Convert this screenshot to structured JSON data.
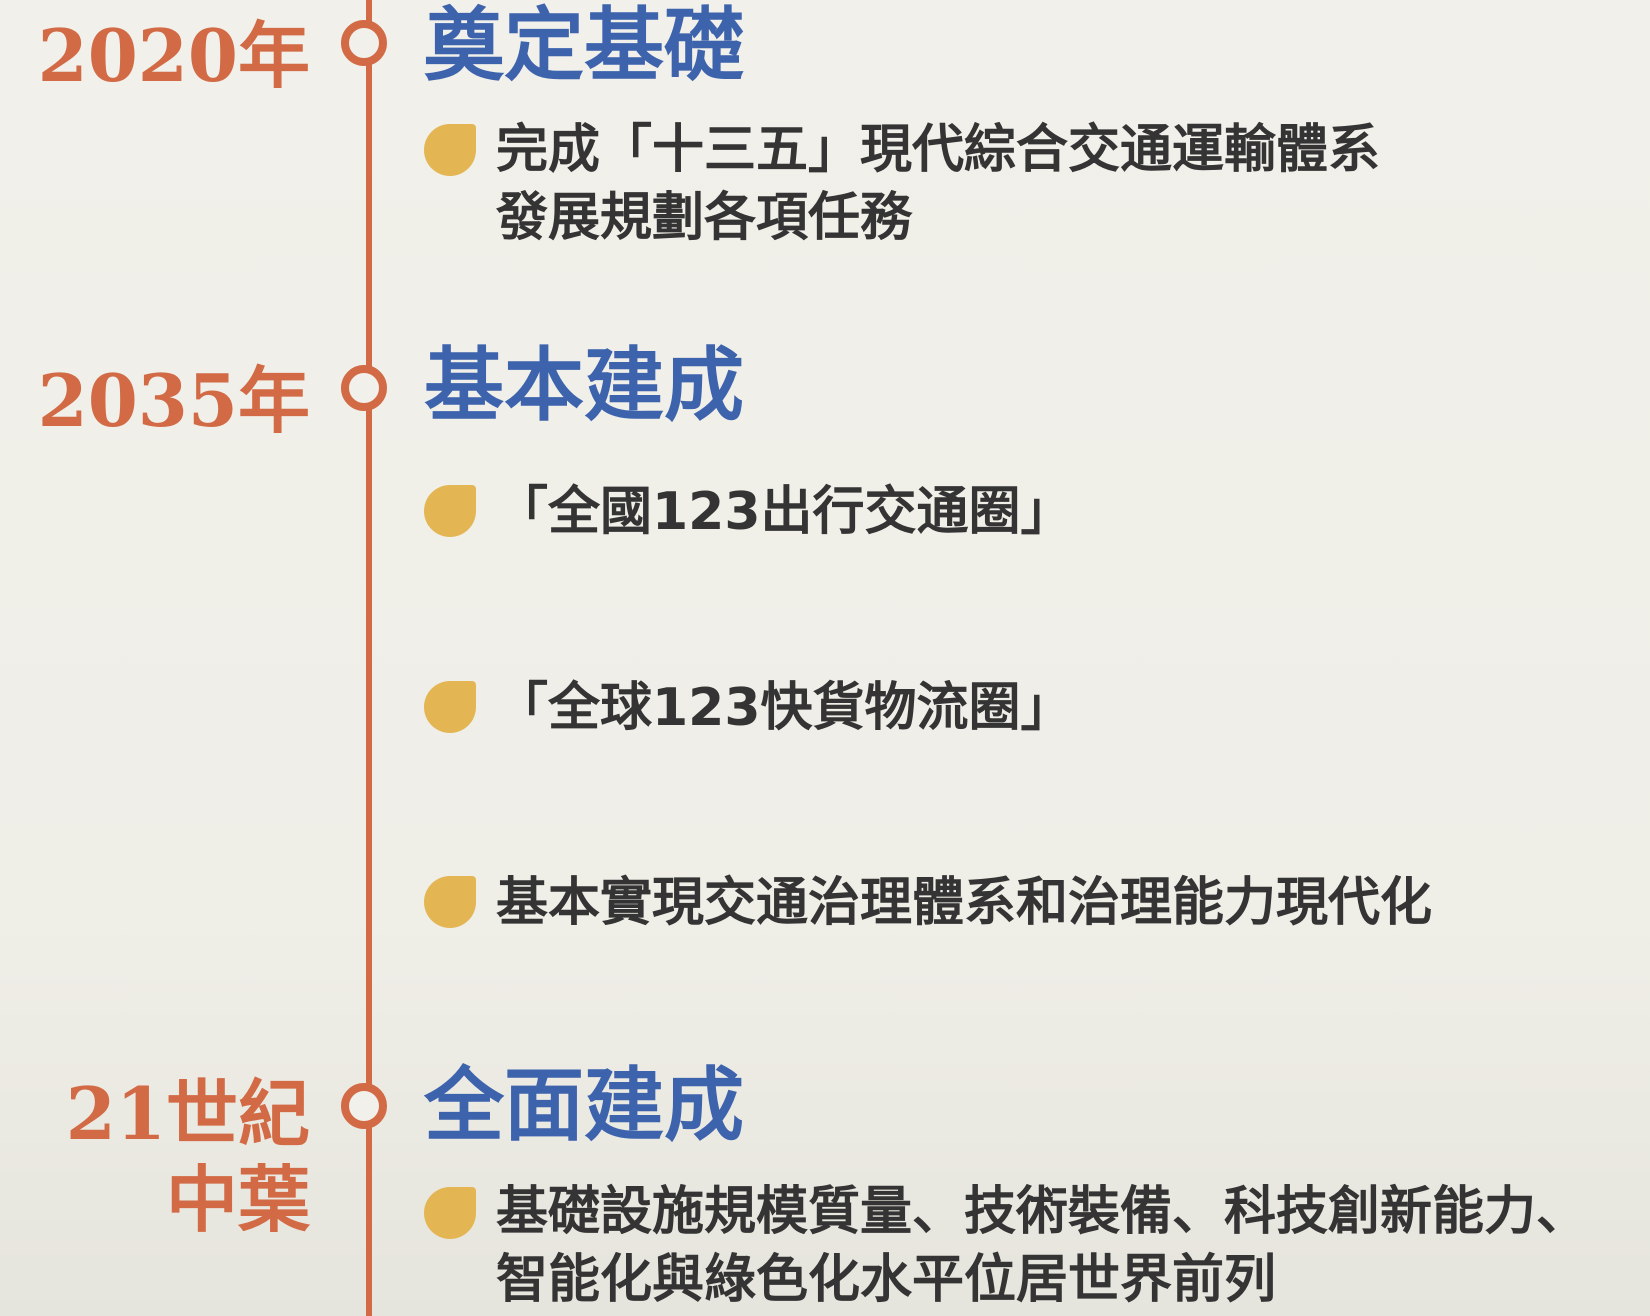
{
  "colors": {
    "timeline": "#d26a45",
    "stage_title": "#3e63ad",
    "bullet": "#e4b553",
    "text": "#343434",
    "background": "#f1f0ea"
  },
  "milestones": [
    {
      "year": "2020年",
      "title": "奠定基礎",
      "items": [
        {
          "line1": "完成「十三五」現代綜合交通運輸體系",
          "line2": "發展規劃各項任務"
        }
      ]
    },
    {
      "year": "2035年",
      "title": "基本建成",
      "items": [
        {
          "line1": "「全國123出行交通圈」"
        },
        {
          "line1": "「全球123快貨物流圈」"
        },
        {
          "line1": "基本實現交通治理體系和治理能力現代化"
        }
      ]
    },
    {
      "year_line1": "21世紀",
      "year_line2": "中葉",
      "title": "全面建成",
      "items": [
        {
          "line1": "基礎設施規模質量、技術裝備、科技創新能力、",
          "line2": "智能化與綠色化水平位居世界前列"
        }
      ]
    }
  ]
}
